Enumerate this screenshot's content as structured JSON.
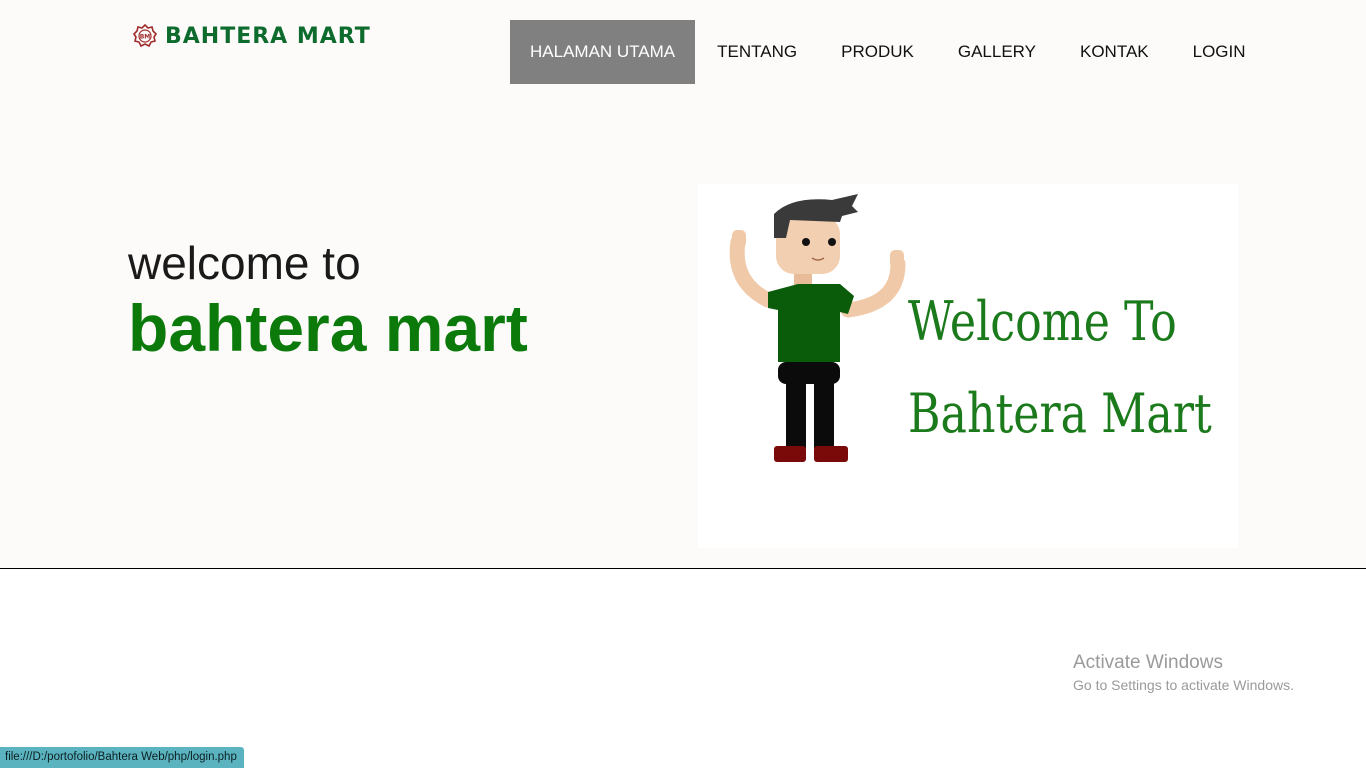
{
  "brand": {
    "name": "BAHTERA MART",
    "emblem_text": "BM",
    "color": "#0d6b2e"
  },
  "nav": {
    "items": [
      {
        "label": "HALAMAN UTAMA",
        "active": true
      },
      {
        "label": "TENTANG"
      },
      {
        "label": "PRODUK"
      },
      {
        "label": "GALLERY"
      },
      {
        "label": "KONTAK"
      },
      {
        "label": "LOGIN"
      }
    ],
    "active_bg": "#808080"
  },
  "hero": {
    "line1": "welcome to",
    "line2": "bahtera mart",
    "accent": "#0b7a0b",
    "image_text_line1": "Welcome To",
    "image_text_line2": "Bahtera Mart"
  },
  "watermark": {
    "title": "Activate Windows",
    "subtitle": "Go to Settings to activate Windows."
  },
  "status_bar": {
    "url": "file:///D:/portofolio/Bahtera Web/php/login.php"
  }
}
